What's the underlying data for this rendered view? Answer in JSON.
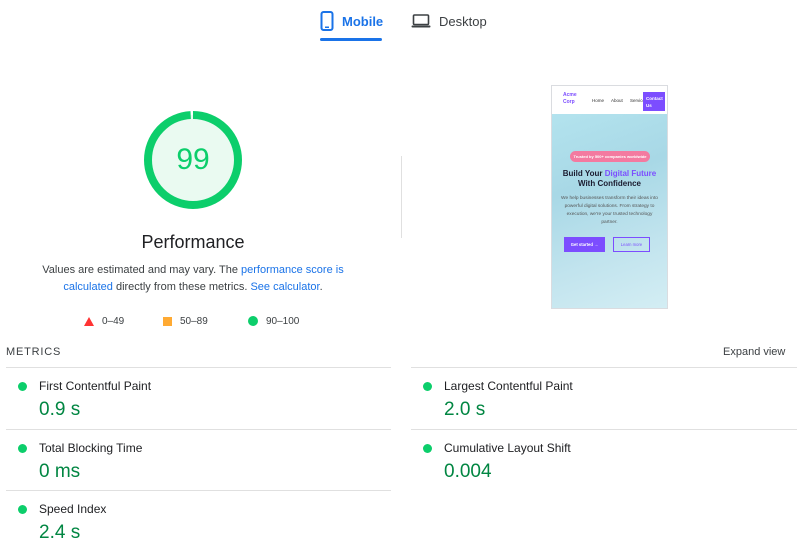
{
  "tabs": {
    "mobile_label": "Mobile",
    "desktop_label": "Desktop",
    "active": "Mobile"
  },
  "score": {
    "value": "99",
    "fraction": 0.99,
    "title": "Performance",
    "desc_part1": "Values are estimated and may vary. The ",
    "desc_link1": "performance score is calculated",
    "desc_part2": " directly from these metrics. ",
    "desc_link2": "See calculator",
    "desc_part3": "."
  },
  "legend": {
    "fail": "0–49",
    "average": "50–89",
    "pass": "90–100"
  },
  "preview": {
    "logo": "Acme Corp",
    "nav": [
      "Home",
      "About",
      "Services"
    ],
    "contact": "Contact Us",
    "badge": "Trusted by 500+ companies worldwide",
    "headline_part1": "Build Your ",
    "headline_accent": "Digital Future",
    "headline_part2": " With Confidence",
    "paragraph": "We help businesses transform their ideas into powerful digital solutions. From strategy to execution, we're your trusted technology partner.",
    "primary_button": "Get started →",
    "secondary_button": "Learn more"
  },
  "metrics": {
    "title": "METRICS",
    "expand": "Expand view",
    "items": [
      {
        "label": "First Contentful Paint",
        "value": "0.9 s"
      },
      {
        "label": "Largest Contentful Paint",
        "value": "2.0 s"
      },
      {
        "label": "Total Blocking Time",
        "value": "0 ms"
      },
      {
        "label": "Cumulative Layout Shift",
        "value": "0.004"
      },
      {
        "label": "Speed Index",
        "value": "2.4 s"
      }
    ]
  },
  "colors": {
    "accent": "#1a73e8",
    "pass": "#0cce6b",
    "pass_text": "#018642",
    "average": "#ffaa33",
    "fail": "#ff3333",
    "brand": "#7c4dff"
  }
}
